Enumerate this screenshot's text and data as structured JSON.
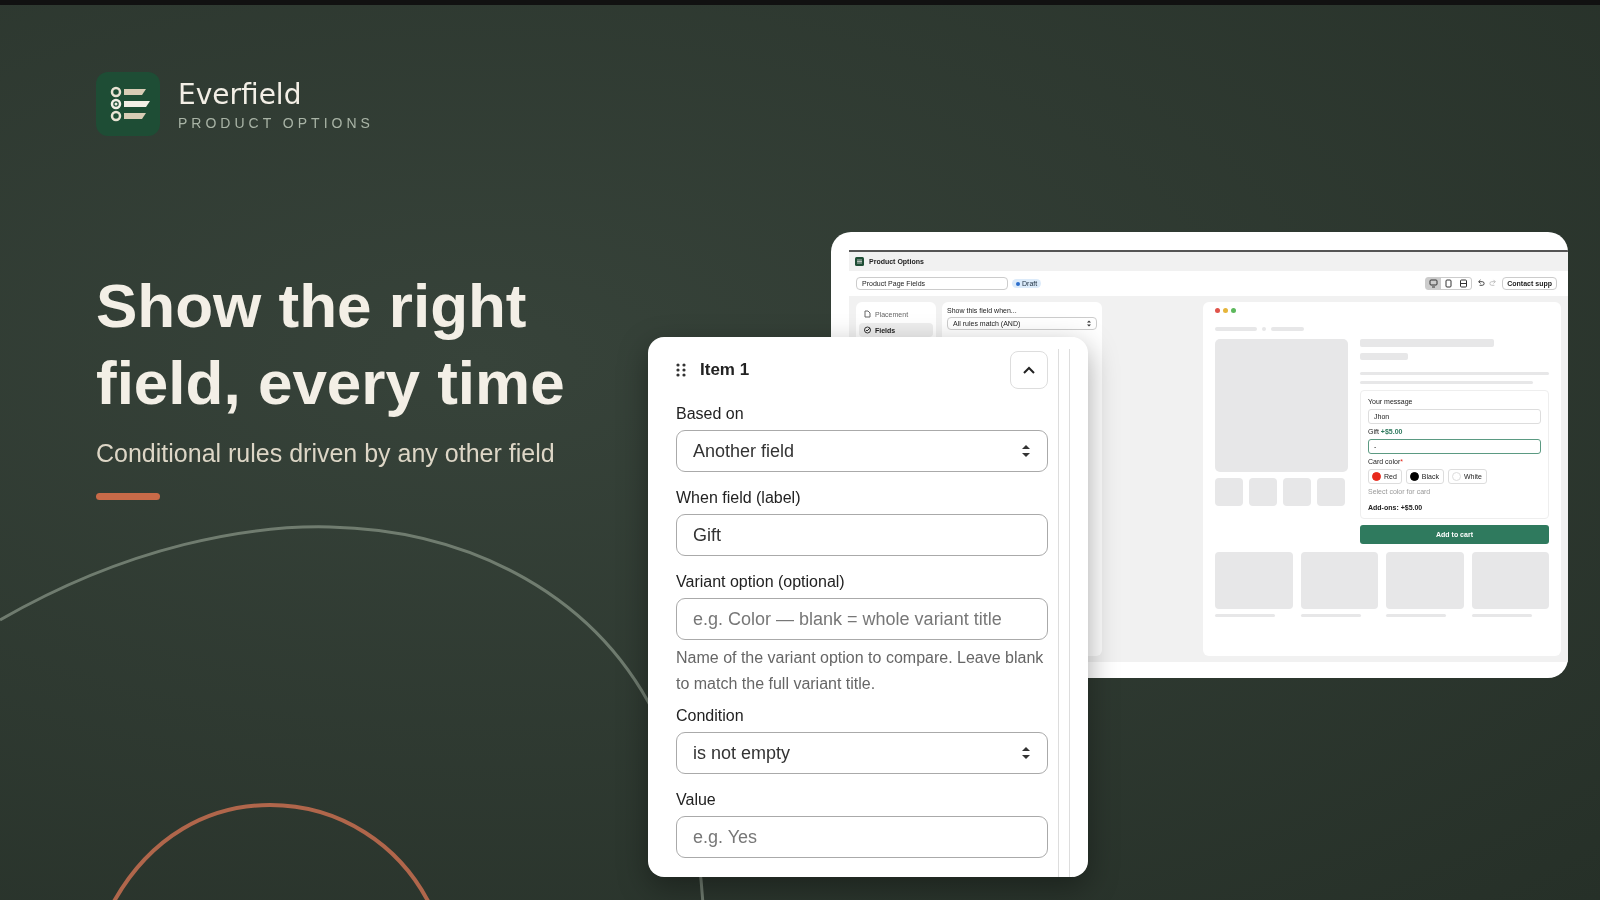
{
  "brand": {
    "name": "Everfield",
    "tagline": "PRODUCT OPTIONS"
  },
  "hero": {
    "headline": "Show the right field, every time",
    "subheadline": "Conditional rules driven by any other field"
  },
  "admin": {
    "app_title": "Product Options",
    "page_name": "Product Page Fields",
    "status": "Draft",
    "view_modes": [
      {
        "selected": true
      },
      {
        "selected": false
      },
      {
        "selected": false
      }
    ],
    "support_button": "Contact supp",
    "nav": [
      {
        "label": "Placement",
        "selected": false
      },
      {
        "label": "Fields",
        "selected": true
      }
    ],
    "rule_heading": "Show this field when...",
    "match_select": "All rules match (AND)",
    "preview": {
      "message_label": "Your message",
      "message_value": "Jhon",
      "gift_label": "Gift",
      "gift_price": "+$5.00",
      "gift_value": "-",
      "card_color_label": "Card color",
      "required_mark": "*",
      "swatches": [
        {
          "label": "Red",
          "color": "#e8291c"
        },
        {
          "label": "Black",
          "color": "#000000"
        },
        {
          "label": "White",
          "color": "#ffffff"
        }
      ],
      "swatch_hint": "Select color for card",
      "addons": "Add-ons: +$5.00",
      "add_to_cart": "Add to cart"
    }
  },
  "rule_item": {
    "title": "Item 1",
    "expanded": true,
    "fields": [
      {
        "kind": "select",
        "label": "Based on",
        "value": "Another field"
      },
      {
        "kind": "text",
        "label": "When field (label)",
        "value": "Gift"
      },
      {
        "kind": "text",
        "label": "Variant option (optional)",
        "placeholder": "e.g. Color — blank = whole variant title",
        "help": "Name of the variant option to compare. Leave blank to match the full variant title."
      },
      {
        "kind": "select",
        "label": "Condition",
        "value": "is not empty"
      },
      {
        "kind": "text",
        "label": "Value",
        "placeholder": "e.g. Yes"
      }
    ]
  }
}
